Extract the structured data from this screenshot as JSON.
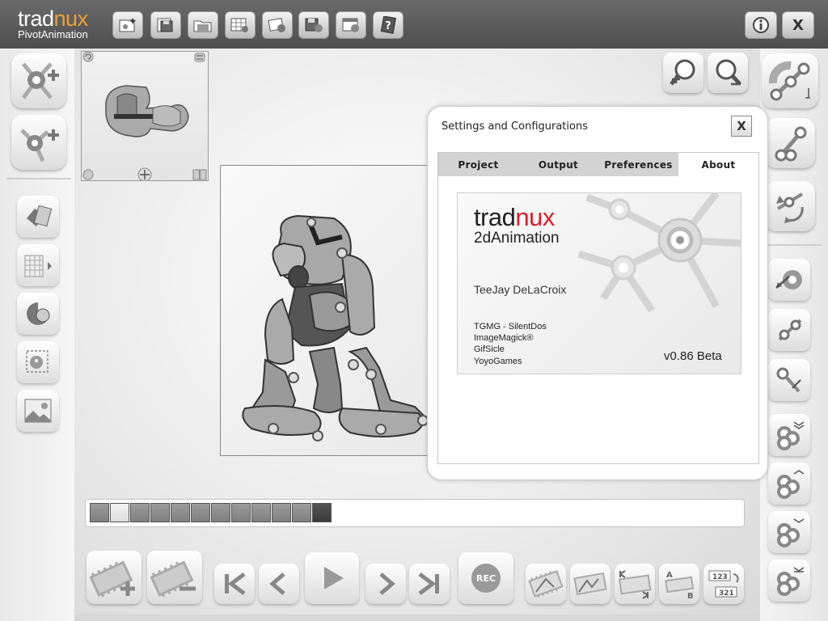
{
  "app": {
    "logo_main": "trad",
    "logo_accent": "nux",
    "logo_sub": "PivotAnimation"
  },
  "toolbar": {
    "buttons": [
      {
        "name": "new-project-icon"
      },
      {
        "name": "save-icon"
      },
      {
        "name": "open-folder-icon"
      },
      {
        "name": "spritesheet-settings-icon"
      },
      {
        "name": "image-settings-icon"
      },
      {
        "name": "save-settings-icon"
      },
      {
        "name": "window-settings-icon"
      },
      {
        "name": "help-icon"
      }
    ],
    "info_label": "i",
    "close_label": "X"
  },
  "dialog": {
    "title": "Settings and Configurations",
    "close_label": "X",
    "tabs": [
      {
        "label": "Project"
      },
      {
        "label": "Output"
      },
      {
        "label": "Preferences"
      },
      {
        "label": "About",
        "active": true
      }
    ],
    "about": {
      "logo_main": "trad",
      "logo_accent": "nux",
      "product": "2dAnimation",
      "author": "TeeJay DeLaCroix",
      "credits": [
        "TGMG - SilentDos",
        "ImageMagick®",
        "GifSicle",
        "YoyoGames"
      ],
      "version": "v0.86 Beta"
    }
  },
  "timeline": {
    "frame_count": 12,
    "selected_frame": 2
  },
  "controls": {
    "rec_label": "REC"
  },
  "colors": {
    "accent_orange": "#f0a030",
    "accent_red": "#d8202a",
    "topbar": "#5a5a5a"
  }
}
